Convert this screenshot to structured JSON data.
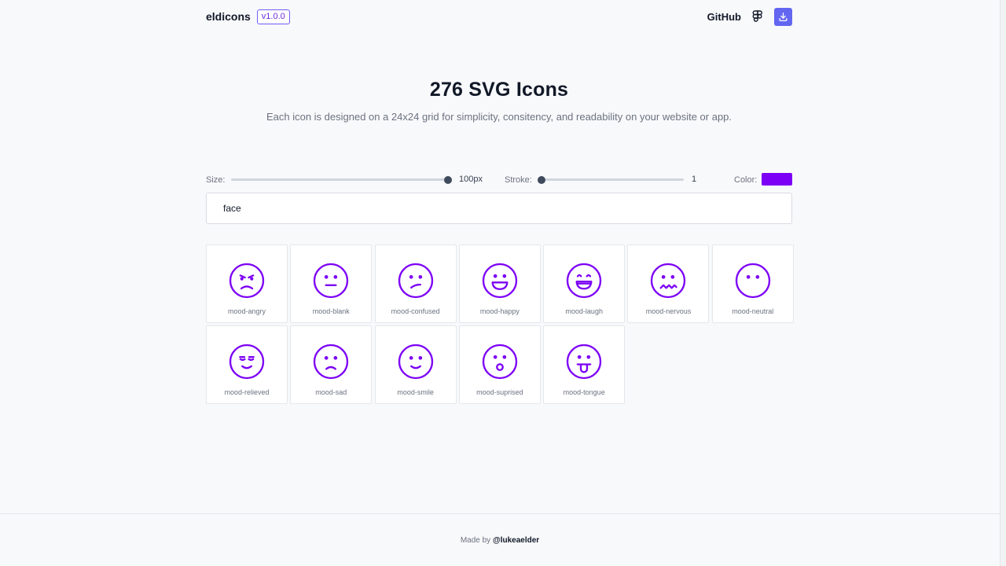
{
  "header": {
    "logo": "eldicons",
    "version": "v1.0.0",
    "github_label": "GitHub",
    "figma_icon": "figma-icon",
    "download_icon": "download-icon"
  },
  "hero": {
    "title": "276 SVG Icons",
    "subtitle": "Each icon is designed on a 24x24 grid for simplicity, consitency, and readability on your website or app."
  },
  "controls": {
    "size_label": "Size:",
    "size_value": "100px",
    "size_fraction": 1.0,
    "stroke_label": "Stroke:",
    "stroke_value": "1",
    "stroke_fraction": 0.0,
    "color_label": "Color:",
    "color_value": "#7c00f5"
  },
  "search": {
    "value": "face"
  },
  "icons": [
    {
      "name": "mood-angry"
    },
    {
      "name": "mood-blank"
    },
    {
      "name": "mood-confused"
    },
    {
      "name": "mood-happy"
    },
    {
      "name": "mood-laugh"
    },
    {
      "name": "mood-nervous"
    },
    {
      "name": "mood-neutral"
    },
    {
      "name": "mood-relieved"
    },
    {
      "name": "mood-sad"
    },
    {
      "name": "mood-smile"
    },
    {
      "name": "mood-suprised"
    },
    {
      "name": "mood-tongue"
    }
  ],
  "footer": {
    "prefix": "Made by",
    "handle": "@lukeaelder"
  }
}
